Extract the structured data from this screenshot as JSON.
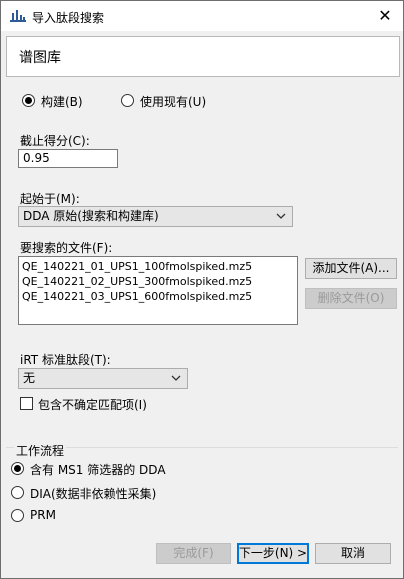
{
  "window": {
    "title": "导入肽段搜索",
    "close_glyph": "✕"
  },
  "header": {
    "title": "谱图库"
  },
  "library_mode": {
    "build_label": "构建(B)",
    "use_existing_label": "使用现有(U)",
    "selected": "build"
  },
  "cutoff": {
    "label": "截止得分(C):",
    "value": "0.95"
  },
  "start_from": {
    "label": "起始于(M):",
    "value": "DDA 原始(搜索和构建库)"
  },
  "files": {
    "label": "要搜索的文件(F):",
    "items": [
      "QE_140221_01_UPS1_100fmolspiked.mz5",
      "QE_140221_02_UPS1_300fmolspiked.mz5",
      "QE_140221_03_UPS1_600fmolspiked.mz5"
    ],
    "add_label": "添加文件(A)...",
    "remove_label": "删除文件(O)"
  },
  "irt": {
    "label": "iRT 标准肽段(T):",
    "value": "无"
  },
  "ambiguous": {
    "label": "包含不确定匹配项(I)",
    "checked": false
  },
  "workflow": {
    "title": "工作流程",
    "options": [
      {
        "label": "含有 MS1 筛选器的 DDA",
        "selected": true
      },
      {
        "label": "DIA(数据非依赖性采集)",
        "selected": false
      },
      {
        "label": "PRM",
        "selected": false
      }
    ]
  },
  "footer": {
    "finish_label": "完成(F)",
    "next_label": "下一步(N) >",
    "cancel_label": "取消"
  }
}
